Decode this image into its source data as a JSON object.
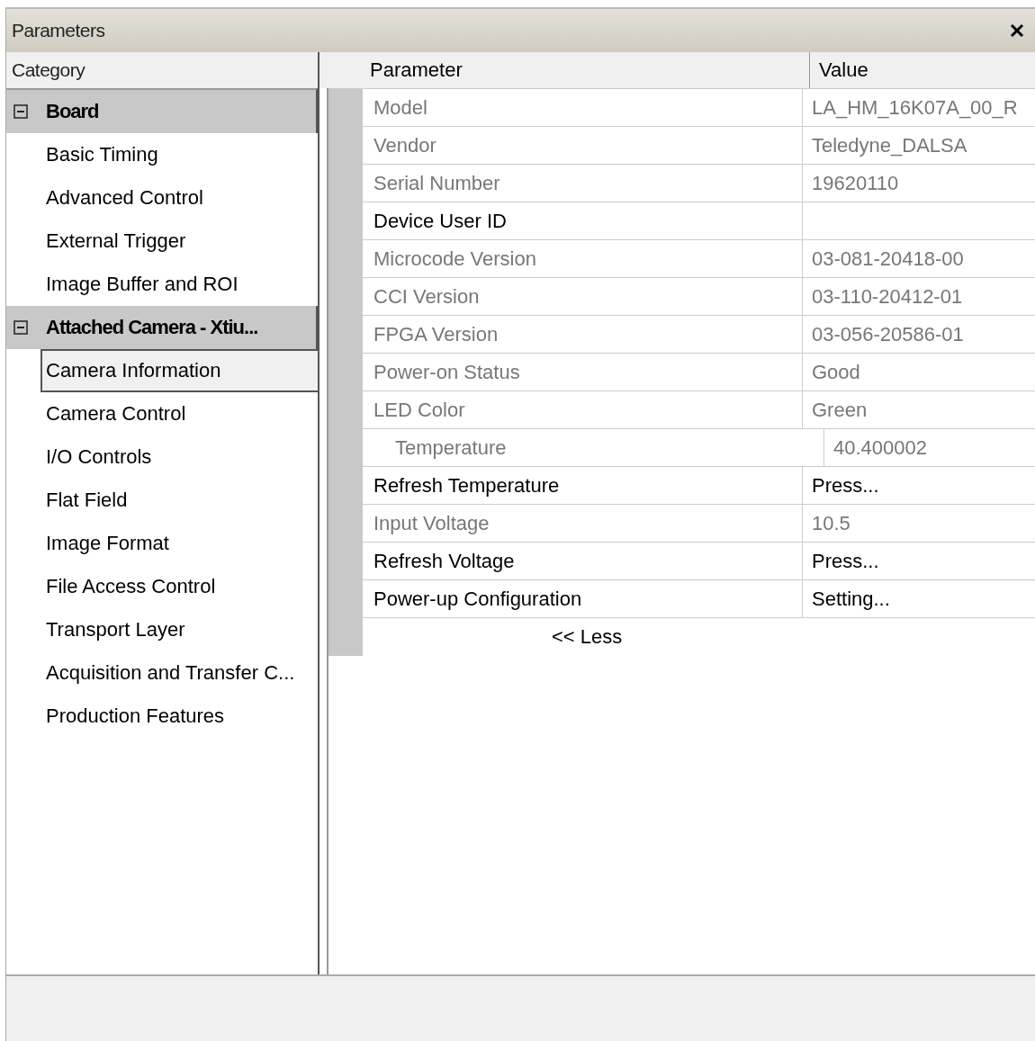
{
  "window": {
    "title": "Parameters"
  },
  "category_header": "Category",
  "columns": [
    "Parameter",
    "Value"
  ],
  "categories": [
    {
      "label": "Board",
      "expanded": true,
      "children": [
        {
          "label": "Basic Timing",
          "selected": false
        },
        {
          "label": "Advanced Control",
          "selected": false
        },
        {
          "label": "External Trigger",
          "selected": false
        },
        {
          "label": "Image Buffer and ROI",
          "selected": false
        }
      ]
    },
    {
      "label": "Attached Camera - Xtiu...",
      "expanded": true,
      "children": [
        {
          "label": "Camera Information",
          "selected": true
        },
        {
          "label": "Camera Control",
          "selected": false
        },
        {
          "label": "I/O Controls",
          "selected": false
        },
        {
          "label": "Flat Field",
          "selected": false
        },
        {
          "label": "Image Format",
          "selected": false
        },
        {
          "label": "File Access Control",
          "selected": false
        },
        {
          "label": "Transport Layer",
          "selected": false
        },
        {
          "label": "Acquisition and Transfer C...",
          "selected": false
        },
        {
          "label": "Production Features",
          "selected": false
        }
      ]
    }
  ],
  "parameters": [
    {
      "name": "Model",
      "value": "LA_HM_16K07A_00_R",
      "disabled": true
    },
    {
      "name": "Vendor",
      "value": "Teledyne_DALSA",
      "disabled": true
    },
    {
      "name": "Serial Number",
      "value": "19620110",
      "disabled": true
    },
    {
      "name": "Device User ID",
      "disabled": false
    },
    {
      "name": "Microcode Version",
      "value": "03-081-20418-00",
      "disabled": true
    },
    {
      "name": "CCI Version",
      "value": "03-110-20412-01",
      "disabled": true
    },
    {
      "name": "FPGA Version",
      "value": "03-056-20586-01",
      "disabled": true
    },
    {
      "name": "Power-on Status",
      "value": "Good",
      "disabled": true
    },
    {
      "name": "LED Color",
      "value": "Green",
      "disabled": true,
      "children": [
        {
          "name": "Temperature",
          "value": "40.400002",
          "disabled": true
        }
      ]
    },
    {
      "name": "Refresh Temperature",
      "value": "Press...",
      "disabled": false
    },
    {
      "name": "Input Voltage",
      "value": "10.5",
      "disabled": true
    },
    {
      "name": "Refresh Voltage",
      "value": "Press...",
      "disabled": false
    },
    {
      "name": "Power-up Configuration",
      "value": "Setting...",
      "disabled": false
    }
  ],
  "less_button": "<< Less"
}
